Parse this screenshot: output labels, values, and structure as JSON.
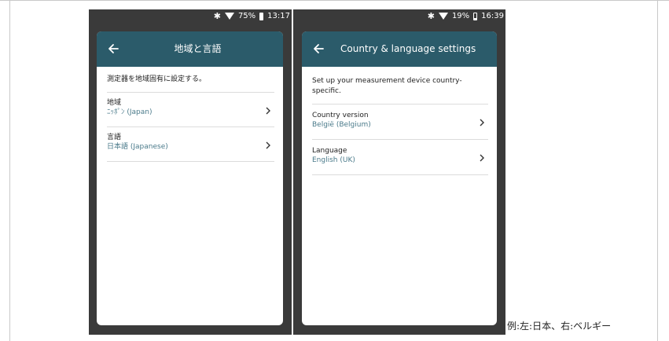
{
  "left_phone": {
    "status": {
      "battery_percent": "75%",
      "time": "13:17"
    },
    "header": {
      "title": "地域と言語",
      "back_icon": "arrow-left-icon"
    },
    "intro": "測定器を地域固有に設定する。",
    "rows": [
      {
        "label": "地域",
        "value": "ﾆｯﾎﾟﾝ (Japan)"
      },
      {
        "label": "言語",
        "value": "日本語 (Japanese)"
      }
    ]
  },
  "right_phone": {
    "status": {
      "battery_percent": "19%",
      "time": "16:39"
    },
    "header": {
      "title": "Country & language settings",
      "back_icon": "arrow-left-icon"
    },
    "intro": "Set up your measurement device country-specific.",
    "rows": [
      {
        "label": "Country version",
        "value": "België (Belgium)"
      },
      {
        "label": "Language",
        "value": "English (UK)"
      }
    ]
  },
  "caption": "例:左:日本、右:ベルギー",
  "colors": {
    "header_bg": "#2b5b6a",
    "value_text": "#4a7a8a",
    "phone_bg": "#3a3a3a"
  }
}
